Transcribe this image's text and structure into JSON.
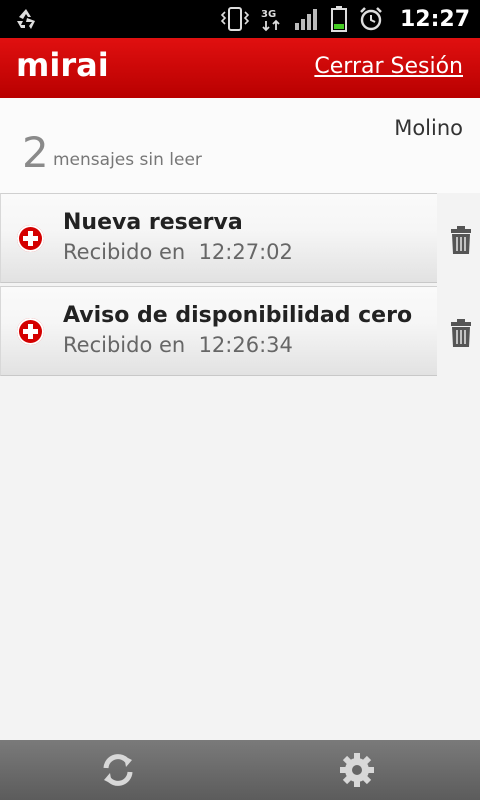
{
  "status_bar": {
    "time": "12:27",
    "icons": [
      "recycle-icon",
      "vibrate-icon",
      "3g-icon",
      "signal-icon",
      "battery-icon",
      "alarm-icon"
    ]
  },
  "header": {
    "logo": "mirai",
    "logout_label": "Cerrar Sesión",
    "color": "#d00000"
  },
  "summary": {
    "user": "Molino",
    "unread_count": "2",
    "unread_label": "mensajes sin leer"
  },
  "messages": [
    {
      "title": "Nueva reserva",
      "received_label": "Recibido en",
      "time": "12:27:02"
    },
    {
      "title": "Aviso de disponibilidad cero",
      "received_label": "Recibido en",
      "time": "12:26:34"
    }
  ],
  "bottom_bar": {
    "buttons": [
      "refresh-icon",
      "settings-icon"
    ]
  }
}
